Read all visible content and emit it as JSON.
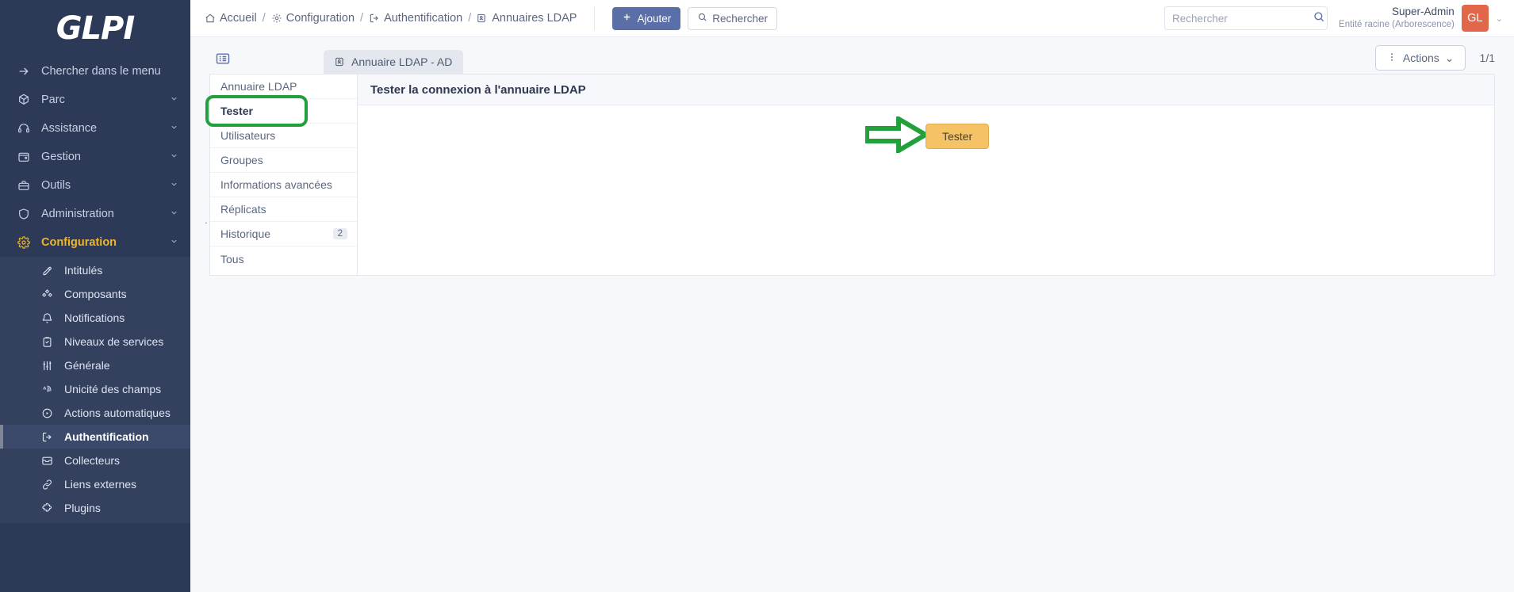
{
  "brand": {
    "logo_text": "GLPI"
  },
  "sidebar": {
    "search_label": "Chercher dans le menu",
    "items": [
      {
        "label": "Parc",
        "icon": "box-icon",
        "expandable": true
      },
      {
        "label": "Assistance",
        "icon": "headset-icon",
        "expandable": true
      },
      {
        "label": "Gestion",
        "icon": "wallet-icon",
        "expandable": true
      },
      {
        "label": "Outils",
        "icon": "briefcase-icon",
        "expandable": true
      },
      {
        "label": "Administration",
        "icon": "shield-icon",
        "expandable": true
      },
      {
        "label": "Configuration",
        "icon": "gear-icon",
        "expandable": true,
        "active": true
      }
    ],
    "sub_items": [
      {
        "label": "Intitulés",
        "icon": "pencil-square-icon"
      },
      {
        "label": "Composants",
        "icon": "components-icon"
      },
      {
        "label": "Notifications",
        "icon": "bell-icon"
      },
      {
        "label": "Niveaux de services",
        "icon": "clipboard-check-icon"
      },
      {
        "label": "Générale",
        "icon": "sliders-icon"
      },
      {
        "label": "Unicité des champs",
        "icon": "fingerprint-icon"
      },
      {
        "label": "Actions automatiques",
        "icon": "gear-play-icon"
      },
      {
        "label": "Authentification",
        "icon": "login-icon",
        "active": true
      },
      {
        "label": "Collecteurs",
        "icon": "inbox-icon"
      },
      {
        "label": "Liens externes",
        "icon": "link-icon"
      },
      {
        "label": "Plugins",
        "icon": "puzzle-icon"
      }
    ]
  },
  "topbar": {
    "breadcrumbs": [
      {
        "label": "Accueil",
        "icon": "home-icon"
      },
      {
        "label": "Configuration",
        "icon": "gear-icon"
      },
      {
        "label": "Authentification",
        "icon": "login-icon"
      },
      {
        "label": "Annuaires LDAP",
        "icon": "contact-card-icon"
      }
    ],
    "separator": "/",
    "add_button": "Ajouter",
    "add_icon": "plus-icon",
    "search_button": "Rechercher",
    "search_button_icon": "search-icon",
    "search": {
      "placeholder": "Rechercher",
      "value": "",
      "icon": "search-icon"
    },
    "user": {
      "name": "Super-Admin",
      "entity": "Entité racine (Arborescence)",
      "avatar_initials": "GL",
      "avatar_color": "#e2674a",
      "chevron": "⌄"
    }
  },
  "tabstrip": {
    "list_toggle_icon": "list-view-icon",
    "tab": {
      "label": "Annuaire LDAP - AD",
      "icon": "contact-card-icon"
    },
    "actions_button": {
      "label": "Actions",
      "icon": "vertical-dots-icon",
      "chevron": "⌄"
    },
    "pager": "1/1"
  },
  "panel": {
    "vtabs": [
      {
        "label": "Annuaire LDAP",
        "badge": ""
      },
      {
        "label": "Tester",
        "badge": "",
        "selected": true,
        "highlighted": true
      },
      {
        "label": "Utilisateurs",
        "badge": ""
      },
      {
        "label": "Groupes",
        "badge": ""
      },
      {
        "label": "Informations avancées",
        "badge": ""
      },
      {
        "label": "Réplicats",
        "badge": ""
      },
      {
        "label": "Historique",
        "badge": "2"
      },
      {
        "label": "Tous",
        "badge": ""
      }
    ],
    "title": "Tester la connexion à l'annuaire LDAP",
    "test_button": "Tester",
    "annotation_arrow_color": "#21a03c",
    "highlight_color": "#21a03c",
    "stray_dot": "."
  }
}
